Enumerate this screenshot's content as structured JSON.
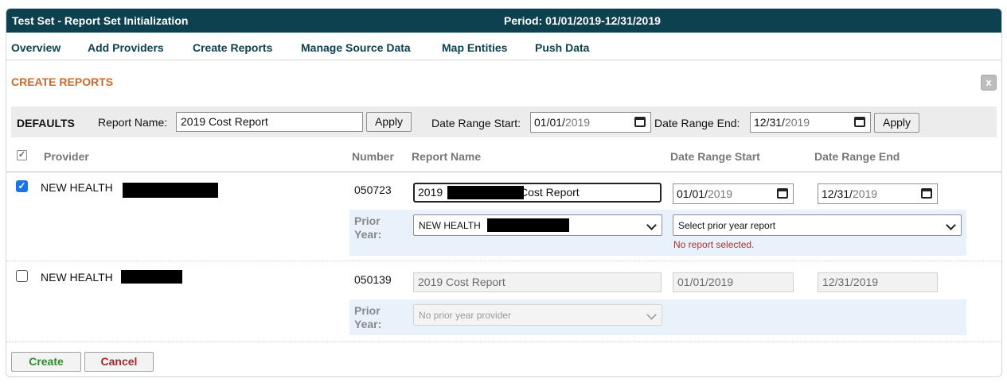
{
  "window": {
    "title": "Test Set - Report Set Initialization",
    "period": "Period: 01/01/2019-12/31/2019"
  },
  "nav": {
    "items": [
      "Overview",
      "Add Providers",
      "Create Reports",
      "Manage Source Data",
      "Map Entities",
      "Push Data"
    ]
  },
  "section": {
    "title": "CREATE REPORTS",
    "close_icon": "x-close-icon",
    "close_glyph": "x"
  },
  "defaults": {
    "label": "DEFAULTS",
    "report_name_label": "Report Name:",
    "report_name_value": "2019 Cost Report",
    "apply_label": "Apply",
    "date_start_label": "Date Range Start:",
    "date_start_md": "01/01/",
    "date_start_year": "2019",
    "date_end_label": "Date Range End:",
    "date_end_md": "12/31/",
    "date_end_year": "2019",
    "apply2_label": "Apply"
  },
  "table": {
    "headers": {
      "provider": "Provider",
      "number": "Number",
      "report_name": "Report Name",
      "date_start": "Date Range Start",
      "date_end": "Date Range End"
    },
    "select_all_glyph": "✓",
    "rows": [
      {
        "checked": true,
        "check_glyph": "✓",
        "provider": "NEW HEALTH",
        "number": "050723",
        "report_name_start": "2019",
        "report_name_end": "Cost Report",
        "date_start_md": "01/01/",
        "date_start_year": "2019",
        "date_end_md": "12/31/",
        "date_end_year": "2019",
        "prior_label_1": "Prior",
        "prior_label_2": "Year:",
        "prior_provider": "NEW HEALTH",
        "prior_report_placeholder": "Select prior year report",
        "error": "No report selected."
      },
      {
        "checked": false,
        "provider": "NEW HEALTH",
        "number": "050139",
        "report_name": "2019 Cost Report",
        "date_start": "01/01/2019",
        "date_end": "12/31/2019",
        "prior_label_1": "Prior",
        "prior_label_2": "Year:",
        "prior_provider": "No prior year provider"
      }
    ]
  },
  "actions": {
    "create_label": "Create",
    "cancel_label": "Cancel",
    "create_color": "#2e8b2e",
    "cancel_color": "#9b2a2a"
  },
  "colors": {
    "titlebar": "#0e4150",
    "section_title": "#c8692b",
    "checkbox_on": "#1a73e8",
    "error": "#b03030"
  }
}
